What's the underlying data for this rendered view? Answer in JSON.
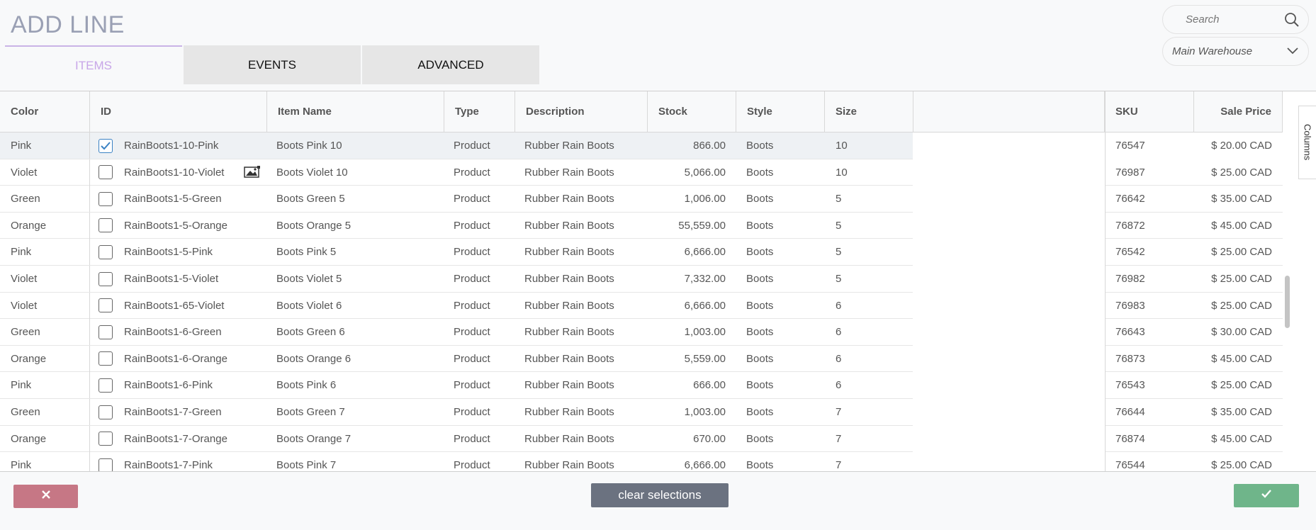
{
  "page": {
    "title": "ADD LINE"
  },
  "tabs": [
    {
      "label": "ITEMS"
    },
    {
      "label": "EVENTS"
    },
    {
      "label": "ADVANCED"
    }
  ],
  "search": {
    "placeholder": "Search"
  },
  "warehouse": {
    "selected": "Main Warehouse"
  },
  "columns_panel_label": "Columns",
  "table": {
    "headers": {
      "color": "Color",
      "id": "ID",
      "item_name": "Item Name",
      "type": "Type",
      "description": "Description",
      "stock": "Stock",
      "style": "Style",
      "size": "Size",
      "sku": "SKU",
      "sale_price": "Sale Price"
    },
    "rows": [
      {
        "color": "Pink",
        "id": "RainBoots1-10-Pink",
        "item_name": "Boots Pink 10",
        "type": "Product",
        "description": "Rubber Rain Boots",
        "stock": "866.00",
        "style": "Boots",
        "size": "10",
        "sku": "76547",
        "sale_price": "$ 20.00 CAD",
        "checked": true,
        "has_image": false
      },
      {
        "color": "Violet",
        "id": "RainBoots1-10-Violet",
        "item_name": "Boots Violet 10",
        "type": "Product",
        "description": "Rubber Rain Boots",
        "stock": "5,066.00",
        "style": "Boots",
        "size": "10",
        "sku": "76987",
        "sale_price": "$ 25.00 CAD",
        "checked": false,
        "has_image": true
      },
      {
        "color": "Green",
        "id": "RainBoots1-5-Green",
        "item_name": "Boots Green 5",
        "type": "Product",
        "description": "Rubber Rain Boots",
        "stock": "1,006.00",
        "style": "Boots",
        "size": "5",
        "sku": "76642",
        "sale_price": "$ 35.00 CAD",
        "checked": false,
        "has_image": false
      },
      {
        "color": "Orange",
        "id": "RainBoots1-5-Orange",
        "item_name": "Boots Orange 5",
        "type": "Product",
        "description": "Rubber Rain Boots",
        "stock": "55,559.00",
        "style": "Boots",
        "size": "5",
        "sku": "76872",
        "sale_price": "$ 45.00 CAD",
        "checked": false,
        "has_image": false
      },
      {
        "color": "Pink",
        "id": "RainBoots1-5-Pink",
        "item_name": "Boots Pink 5",
        "type": "Product",
        "description": "Rubber Rain Boots",
        "stock": "6,666.00",
        "style": "Boots",
        "size": "5",
        "sku": "76542",
        "sale_price": "$ 25.00 CAD",
        "checked": false,
        "has_image": false
      },
      {
        "color": "Violet",
        "id": "RainBoots1-5-Violet",
        "item_name": "Boots Violet 5",
        "type": "Product",
        "description": "Rubber Rain Boots",
        "stock": "7,332.00",
        "style": "Boots",
        "size": "5",
        "sku": "76982",
        "sale_price": "$ 25.00 CAD",
        "checked": false,
        "has_image": false
      },
      {
        "color": "Violet",
        "id": "RainBoots1-65-Violet",
        "item_name": "Boots Violet 6",
        "type": "Product",
        "description": "Rubber Rain Boots",
        "stock": "6,666.00",
        "style": "Boots",
        "size": "6",
        "sku": "76983",
        "sale_price": "$ 25.00 CAD",
        "checked": false,
        "has_image": false
      },
      {
        "color": "Green",
        "id": "RainBoots1-6-Green",
        "item_name": "Boots Green 6",
        "type": "Product",
        "description": "Rubber Rain Boots",
        "stock": "1,003.00",
        "style": "Boots",
        "size": "6",
        "sku": "76643",
        "sale_price": "$ 30.00 CAD",
        "checked": false,
        "has_image": false
      },
      {
        "color": "Orange",
        "id": "RainBoots1-6-Orange",
        "item_name": "Boots Orange 6",
        "type": "Product",
        "description": "Rubber Rain Boots",
        "stock": "5,559.00",
        "style": "Boots",
        "size": "6",
        "sku": "76873",
        "sale_price": "$ 45.00 CAD",
        "checked": false,
        "has_image": false
      },
      {
        "color": "Pink",
        "id": "RainBoots1-6-Pink",
        "item_name": "Boots Pink 6",
        "type": "Product",
        "description": "Rubber Rain Boots",
        "stock": "666.00",
        "style": "Boots",
        "size": "6",
        "sku": "76543",
        "sale_price": "$ 25.00 CAD",
        "checked": false,
        "has_image": false
      },
      {
        "color": "Green",
        "id": "RainBoots1-7-Green",
        "item_name": "Boots Green 7",
        "type": "Product",
        "description": "Rubber Rain Boots",
        "stock": "1,003.00",
        "style": "Boots",
        "size": "7",
        "sku": "76644",
        "sale_price": "$ 35.00 CAD",
        "checked": false,
        "has_image": false
      },
      {
        "color": "Orange",
        "id": "RainBoots1-7-Orange",
        "item_name": "Boots Orange 7",
        "type": "Product",
        "description": "Rubber Rain Boots",
        "stock": "670.00",
        "style": "Boots",
        "size": "7",
        "sku": "76874",
        "sale_price": "$ 45.00 CAD",
        "checked": false,
        "has_image": false
      },
      {
        "color": "Pink",
        "id": "RainBoots1-7-Pink",
        "item_name": "Boots Pink 7",
        "type": "Product",
        "description": "Rubber Rain Boots",
        "stock": "6,666.00",
        "style": "Boots",
        "size": "7",
        "sku": "76544",
        "sale_price": "$ 25.00 CAD",
        "checked": false,
        "has_image": false
      }
    ]
  },
  "footer": {
    "cancel_icon": "close-icon",
    "clear_label": "clear selections",
    "confirm_icon": "check-icon"
  },
  "colors": {
    "accent": "#c8a6e8",
    "cancel": "#c67785",
    "clear": "#6b7280",
    "confirm": "#6fb58a"
  }
}
